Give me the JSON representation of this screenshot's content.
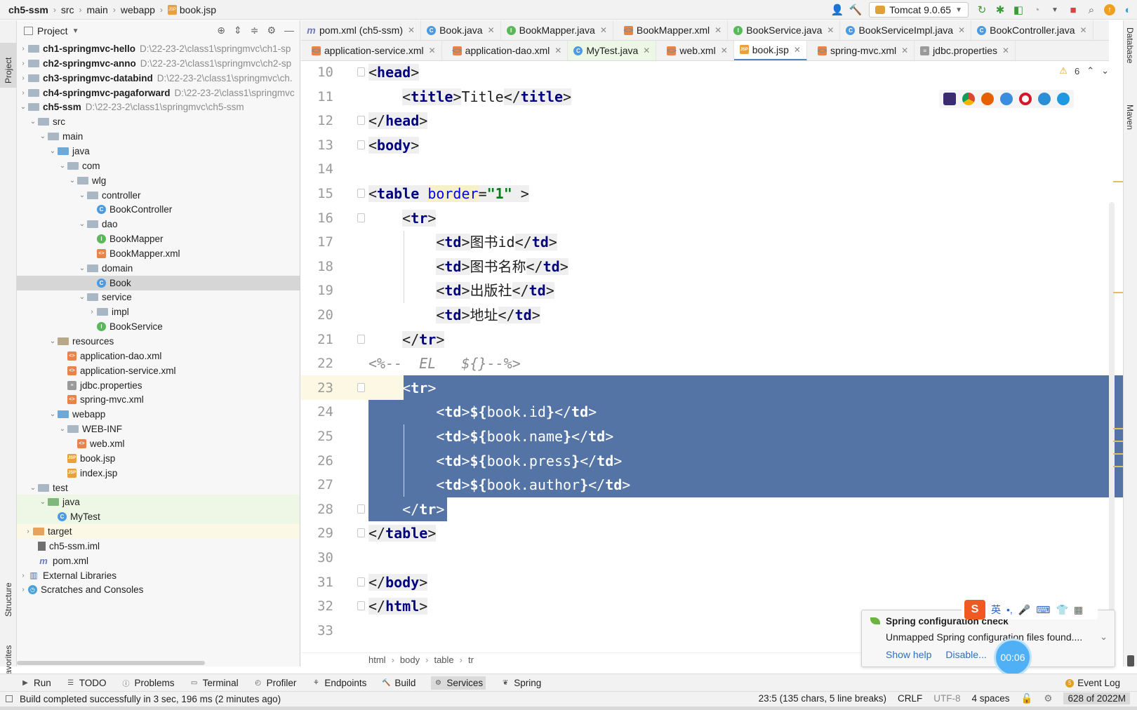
{
  "navbar": {
    "breadcrumb": [
      "ch5-ssm",
      "src",
      "main",
      "webapp",
      "book.jsp"
    ],
    "run_config": "Tomcat 9.0.65"
  },
  "left_stripe": {
    "project": "Project",
    "structure": "Structure",
    "favorites": "Favorites"
  },
  "right_stripe": {
    "database": "Database",
    "maven": "Maven"
  },
  "project_panel": {
    "title": "Project",
    "tree": [
      {
        "label": "ch1-springmvc-hello",
        "path": "D:\\22-23-2\\class1\\springmvc\\ch1-sp",
        "bold": true
      },
      {
        "label": "ch2-springmvc-anno",
        "path": "D:\\22-23-2\\class1\\springmvc\\ch2-sp",
        "bold": true
      },
      {
        "label": "ch3-springmvc-databind",
        "path": "D:\\22-23-2\\class1\\springmvc\\ch.",
        "bold": true
      },
      {
        "label": "ch4-springmvc-pagaforward",
        "path": "D:\\22-23-2\\class1\\springmvc",
        "bold": true
      },
      {
        "label": "ch5-ssm",
        "path": "D:\\22-23-2\\class1\\springmvc\\ch5-ssm",
        "bold": true
      },
      {
        "label": "src"
      },
      {
        "label": "main"
      },
      {
        "label": "java"
      },
      {
        "label": "com"
      },
      {
        "label": "wlg"
      },
      {
        "label": "controller"
      },
      {
        "label": "BookController"
      },
      {
        "label": "dao"
      },
      {
        "label": "BookMapper"
      },
      {
        "label": "BookMapper.xml"
      },
      {
        "label": "domain"
      },
      {
        "label": "Book"
      },
      {
        "label": "service"
      },
      {
        "label": "impl"
      },
      {
        "label": "BookService"
      },
      {
        "label": "resources"
      },
      {
        "label": "application-dao.xml"
      },
      {
        "label": "application-service.xml"
      },
      {
        "label": "jdbc.properties"
      },
      {
        "label": "spring-mvc.xml"
      },
      {
        "label": "webapp"
      },
      {
        "label": "WEB-INF"
      },
      {
        "label": "web.xml"
      },
      {
        "label": "book.jsp"
      },
      {
        "label": "index.jsp"
      },
      {
        "label": "test"
      },
      {
        "label": "java"
      },
      {
        "label": "MyTest"
      },
      {
        "label": "target"
      },
      {
        "label": "ch5-ssm.iml"
      },
      {
        "label": "pom.xml"
      },
      {
        "label": "External Libraries"
      },
      {
        "label": "Scratches and Consoles"
      }
    ]
  },
  "editor_tabs_row1": [
    {
      "label": "pom.xml (ch5-ssm)",
      "icon": "maven-icon"
    },
    {
      "label": "Book.java",
      "icon": "class-icon"
    },
    {
      "label": "BookMapper.java",
      "icon": "interface-icon"
    },
    {
      "label": "BookMapper.xml",
      "icon": "xml-icon"
    },
    {
      "label": "BookService.java",
      "icon": "interface-icon"
    },
    {
      "label": "BookServiceImpl.java",
      "icon": "class-icon"
    },
    {
      "label": "BookController.java",
      "icon": "class-icon"
    }
  ],
  "editor_tabs_row2": [
    {
      "label": "application-service.xml",
      "icon": "xml-icon"
    },
    {
      "label": "application-dao.xml",
      "icon": "xml-icon"
    },
    {
      "label": "MyTest.java",
      "icon": "class-icon"
    },
    {
      "label": "web.xml",
      "icon": "xml-icon"
    },
    {
      "label": "book.jsp",
      "icon": "jsp-icon",
      "active": true
    },
    {
      "label": "spring-mvc.xml",
      "icon": "xml-icon"
    },
    {
      "label": "jdbc.properties",
      "icon": "properties-icon"
    }
  ],
  "editor": {
    "warnings": "6",
    "lines": [
      {
        "n": "10",
        "text": "<head>"
      },
      {
        "n": "11",
        "text": "    <title>Title</title>"
      },
      {
        "n": "12",
        "text": "</head>"
      },
      {
        "n": "13",
        "text": "<body>"
      },
      {
        "n": "14",
        "text": ""
      },
      {
        "n": "15",
        "text": "<table border=\"1\" >"
      },
      {
        "n": "16",
        "text": "    <tr>"
      },
      {
        "n": "17",
        "text": "        <td>图书id</td>"
      },
      {
        "n": "18",
        "text": "        <td>图书名称</td>"
      },
      {
        "n": "19",
        "text": "        <td>出版社</td>"
      },
      {
        "n": "20",
        "text": "        <td>地址</td>"
      },
      {
        "n": "21",
        "text": "    </tr>"
      },
      {
        "n": "22",
        "text": "<%--  EL   ${}--%>"
      },
      {
        "n": "23",
        "text": "    <tr>"
      },
      {
        "n": "24",
        "text": "        <td>${book.id}</td>"
      },
      {
        "n": "25",
        "text": "        <td>${book.name}</td>"
      },
      {
        "n": "26",
        "text": "        <td>${book.press}</td>"
      },
      {
        "n": "27",
        "text": "        <td>${book.author}</td>"
      },
      {
        "n": "28",
        "text": "    </tr>"
      },
      {
        "n": "29",
        "text": "</table>"
      },
      {
        "n": "30",
        "text": ""
      },
      {
        "n": "31",
        "text": "</body>"
      },
      {
        "n": "32",
        "text": "</html>"
      },
      {
        "n": "33",
        "text": ""
      }
    ],
    "breadcrumb": [
      "html",
      "body",
      "table",
      "tr"
    ]
  },
  "notification": {
    "title": "Spring configuration check",
    "body": "Unmapped Spring configuration files found....",
    "link_help": "Show help",
    "link_disable": "Disable..."
  },
  "ime": {
    "lang": "英"
  },
  "timer": "00:06",
  "tool_windows": [
    {
      "label": "Run",
      "icon": "run-icon"
    },
    {
      "label": "TODO",
      "icon": "todo-icon"
    },
    {
      "label": "Problems",
      "icon": "problems-icon"
    },
    {
      "label": "Terminal",
      "icon": "terminal-icon"
    },
    {
      "label": "Profiler",
      "icon": "profiler-icon"
    },
    {
      "label": "Endpoints",
      "icon": "endpoints-icon"
    },
    {
      "label": "Build",
      "icon": "build-icon"
    },
    {
      "label": "Services",
      "icon": "services-icon"
    },
    {
      "label": "Spring",
      "icon": "spring-icon"
    }
  ],
  "event_log": {
    "count": "5",
    "label": "Event Log"
  },
  "status": {
    "message": "Build completed successfully in 3 sec, 196 ms (2 minutes ago)",
    "position": "23:5 (135 chars, 5 line breaks)",
    "line_sep": "CRLF",
    "encoding": "UTF-8",
    "indent": "4 spaces",
    "memory": "628 of 2022M"
  }
}
